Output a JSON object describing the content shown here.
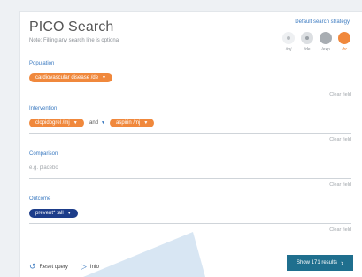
{
  "header": {
    "title": "PICO Search",
    "note": "Note: Filling any search line is optional",
    "strategy_label": "Default search strategy",
    "strategies": [
      {
        "label": "/mj"
      },
      {
        "label": "/de"
      },
      {
        "label": "/exp"
      },
      {
        "label": "/br"
      }
    ]
  },
  "population": {
    "label": "Population",
    "tags": [
      "cardiovascular disease /de"
    ],
    "clear": "Clear field"
  },
  "intervention": {
    "label": "Intervention",
    "tags": [
      "clopidogrel /mj",
      "aspirin /mj"
    ],
    "connector": "and",
    "clear": "Clear field"
  },
  "comparison": {
    "label": "Comparison",
    "placeholder": "e.g. placebo",
    "clear": "Clear field"
  },
  "outcome": {
    "label": "Outcome",
    "tags": [
      "prevent* :all"
    ],
    "clear": "Clear field"
  },
  "footer": {
    "reset_label": "Reset query",
    "info_label": "Info",
    "results_label": "Show 171 results"
  },
  "colors": {
    "accent_orange": "#f0883c",
    "accent_blue": "#3b7ac0",
    "tag_navy": "#1d3d8a",
    "results_button": "#1f6f8e"
  }
}
